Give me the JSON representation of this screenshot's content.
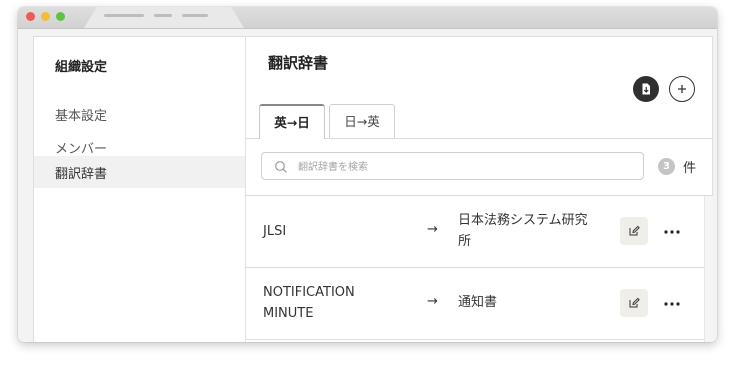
{
  "colors": {
    "accent_dark": "#2f2f2f",
    "active_sidebar_bg": "#f1f1f1",
    "edit_button_bg": "#f0eee8"
  },
  "sidebar": {
    "title": "組織設定",
    "items": [
      {
        "label": "基本設定",
        "active": false
      },
      {
        "label": "メンバー",
        "active": false
      },
      {
        "label": "翻訳辞書",
        "active": true
      }
    ]
  },
  "main": {
    "title": "翻訳辞書",
    "actions": {
      "export_icon": "file-export-icon",
      "add_icon": "plus-icon"
    },
    "tabs": [
      {
        "label": "英→日",
        "active": true
      },
      {
        "label": "日→英",
        "active": false
      }
    ],
    "search": {
      "placeholder": "翻訳辞書を検索",
      "value": ""
    },
    "count": {
      "value": "3",
      "unit": "件"
    },
    "entries": [
      {
        "source": [
          "JLSI"
        ],
        "arrow": "→",
        "target": [
          "日本法務システム研究",
          "所"
        ]
      },
      {
        "source": [
          "NOTIFICATION",
          "MINUTE"
        ],
        "arrow": "→",
        "target": [
          "通知書"
        ]
      }
    ]
  }
}
